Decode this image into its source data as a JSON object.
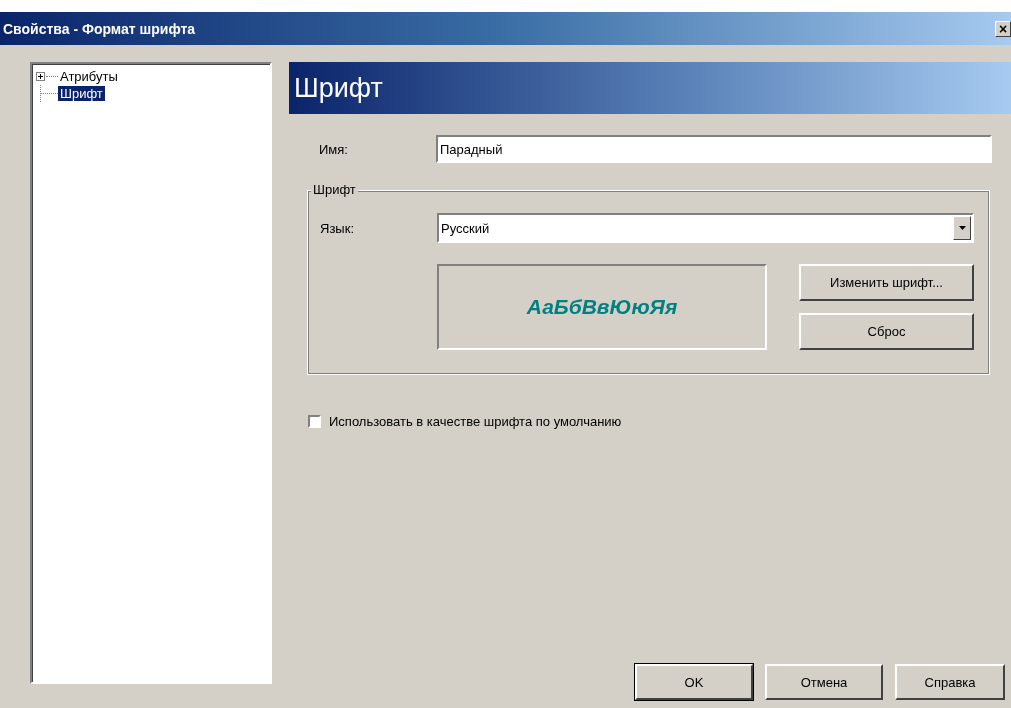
{
  "window": {
    "title": "Свойства - Формат шрифта",
    "close": "×"
  },
  "tree": {
    "items": [
      {
        "label": "Атрибуты",
        "kind": "branch",
        "expanded": false,
        "selected": false
      },
      {
        "label": "Шрифт",
        "kind": "leaf",
        "selected": true
      }
    ]
  },
  "header": "Шрифт",
  "name_field": {
    "label": "Имя:",
    "value": "Парадный"
  },
  "font_group": {
    "legend": "Шрифт",
    "language": {
      "label": "Язык:",
      "value": "Русский"
    },
    "preview": "АаБбВвЮюЯя",
    "buttons": [
      "Изменить шрифт...",
      "Сброс"
    ]
  },
  "default_checkbox": {
    "label": "Использовать в качестве шрифта по умолчанию",
    "checked": false
  },
  "buttons": [
    {
      "label": "OK",
      "default": true
    },
    {
      "label": "Отмена",
      "default": false
    },
    {
      "label": "Справка",
      "default": false
    }
  ]
}
